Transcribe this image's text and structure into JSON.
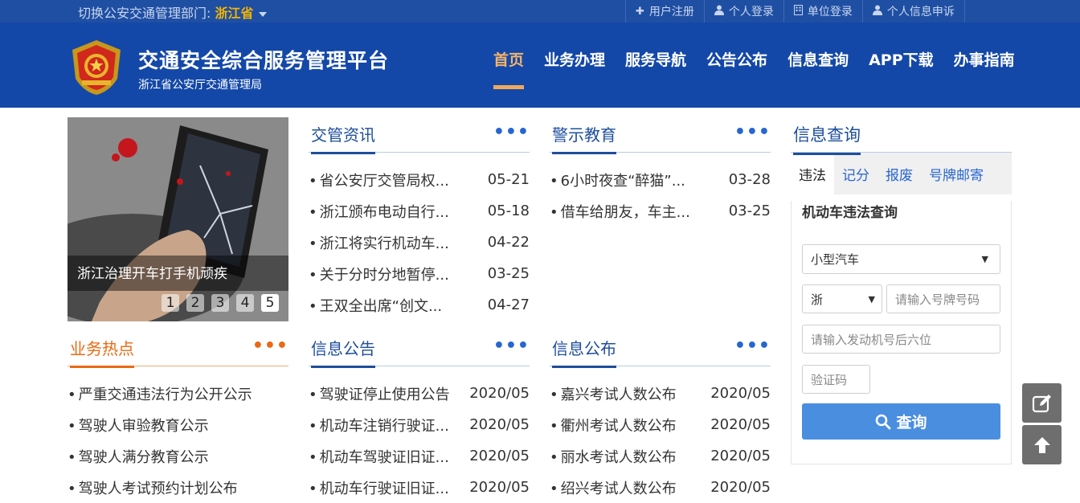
{
  "topbar": {
    "switch_label": "切换公安交通管理部门: ",
    "province": "浙江省",
    "links": [
      {
        "icon": "plus-icon",
        "label": "用户注册"
      },
      {
        "icon": "user-icon",
        "label": "个人登录"
      },
      {
        "icon": "building-icon",
        "label": "单位登录"
      },
      {
        "icon": "user-icon",
        "label": "个人信息申诉"
      }
    ]
  },
  "header": {
    "title": "交通安全综合服务管理平台",
    "subtitle": "浙江省公安厅交通管理局",
    "nav": [
      "首页",
      "业务办理",
      "服务导航",
      "公告公布",
      "信息查询",
      "APP下载",
      "办事指南"
    ],
    "active_nav": "首页",
    "bg_color": "#1448a8",
    "accent_color": "#f0a95b"
  },
  "slideshow": {
    "caption": "浙江治理开车打手机顽疾",
    "pages": [
      "1",
      "2",
      "3",
      "4",
      "5"
    ],
    "active_page": "5"
  },
  "panels": {
    "news": {
      "title": "交管资讯",
      "more": "•••",
      "items": [
        {
          "text": "省公安厅交管局权...",
          "date": "05-21"
        },
        {
          "text": "浙江颁布电动自行...",
          "date": "05-18"
        },
        {
          "text": "浙江将实行机动车...",
          "date": "04-22"
        },
        {
          "text": "关于分时分地暂停...",
          "date": "03-25"
        },
        {
          "text": "王双全出席“创文...",
          "date": "04-27"
        }
      ]
    },
    "warning": {
      "title": "警示教育",
      "more": "•••",
      "items": [
        {
          "text": "6小时夜查“醉猫”...",
          "date": "03-28"
        },
        {
          "text": "借车给朋友，车主...",
          "date": "03-25"
        }
      ]
    },
    "hot": {
      "title": "业务热点",
      "more": "•••",
      "items": [
        {
          "text": "严重交通违法行为公开公示",
          "date": ""
        },
        {
          "text": "驾驶人审验教育公示",
          "date": ""
        },
        {
          "text": "驾驶人满分教育公示",
          "date": ""
        },
        {
          "text": "驾驶人考试预约计划公布",
          "date": ""
        }
      ]
    },
    "notice": {
      "title": "信息公告",
      "more": "•••",
      "items": [
        {
          "text": "驾驶证停止使用公告",
          "date": "2020/05"
        },
        {
          "text": "机动车注销行驶证...",
          "date": "2020/05"
        },
        {
          "text": "机动车驾驶证旧证...",
          "date": "2020/05"
        },
        {
          "text": "机动车行驶证旧证...",
          "date": "2020/05"
        }
      ]
    },
    "publish": {
      "title": "信息公布",
      "more": "•••",
      "items": [
        {
          "text": "嘉兴考试人数公布",
          "date": "2020/05"
        },
        {
          "text": "衢州考试人数公布",
          "date": "2020/05"
        },
        {
          "text": "丽水考试人数公布",
          "date": "2020/05"
        },
        {
          "text": "绍兴考试人数公布",
          "date": "2020/05"
        }
      ]
    }
  },
  "query": {
    "title": "信息查询",
    "tabs": [
      "违法",
      "记分",
      "报废",
      "号牌邮寄"
    ],
    "active_tab": "违法",
    "form_title": "机动车违法查询",
    "vehicle_type": "小型汽车",
    "plate_prefix": "浙",
    "plate_placeholder": "请输入号牌号码",
    "engine_placeholder": "请输入发动机号后六位",
    "captcha_placeholder": "验证码",
    "submit_label": "查询",
    "button_color": "#4a8ee0"
  },
  "side_tools": [
    {
      "icon": "edit-icon"
    },
    {
      "icon": "arrow-up-icon"
    }
  ]
}
